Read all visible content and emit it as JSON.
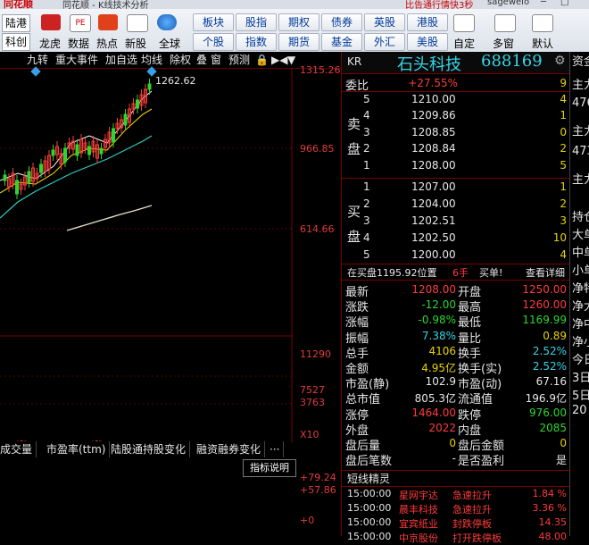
{
  "window": {
    "title_left": "同花顺 - K线技术分析",
    "title_right": "比告通行情快3秒",
    "user": "sagewelo"
  },
  "toolbar": {
    "left_items": [
      "陆港",
      "科创"
    ],
    "icon_labels": [
      "龙虎",
      "数据",
      "热点",
      "新股",
      "全球"
    ],
    "nav_row1": [
      "板块",
      "股指",
      "期权",
      "债券",
      "英股",
      "港股"
    ],
    "nav_row2": [
      "个股",
      "指数",
      "期货",
      "基金",
      "外汇",
      "美股"
    ],
    "right_labels": [
      "自定",
      "多窗",
      "默认"
    ]
  },
  "chart": {
    "tabs": [
      "九转",
      "重大事件",
      "加自选",
      "均线",
      "除权",
      "叠",
      "窗",
      "预测"
    ],
    "peak_label": "1262.62",
    "y_labels": [
      "1315.26",
      "966.85",
      "614.66",
      "11290",
      "7527",
      "3763",
      "X10",
      "+79.24",
      "+57.86",
      "+0"
    ],
    "indicator_tabs": [
      "成交量",
      "市盈率(ttm)",
      "陆股通持股变化",
      "融资融券变化",
      "···"
    ],
    "indicator_button": "指标说明"
  },
  "quote": {
    "code": "KR",
    "name": "石头科技",
    "symbol": "688169",
    "webi_label": "委比",
    "webi_value": "+27.55%",
    "webi_right": "9",
    "sell_label": [
      "卖",
      "盘"
    ],
    "buy_label": [
      "买",
      "盘"
    ],
    "sell": [
      {
        "n": "5",
        "p": "1210.00",
        "v": "4"
      },
      {
        "n": "4",
        "p": "1209.86",
        "v": "1"
      },
      {
        "n": "3",
        "p": "1208.85",
        "v": "0"
      },
      {
        "n": "2",
        "p": "1208.84",
        "v": "2"
      },
      {
        "n": "1",
        "p": "1208.00",
        "v": "5"
      }
    ],
    "buy": [
      {
        "n": "1",
        "p": "1207.00",
        "v": "1"
      },
      {
        "n": "2",
        "p": "1204.00",
        "v": "2"
      },
      {
        "n": "3",
        "p": "1202.51",
        "v": "3"
      },
      {
        "n": "4",
        "p": "1202.50",
        "v": "10"
      },
      {
        "n": "5",
        "p": "1200.00",
        "v": "4"
      }
    ],
    "bar_text": "在买盘1195.92位置",
    "bar_hands": "6手",
    "bar_buy": "买单!",
    "bar_detail": "查看详细",
    "stats_left": [
      {
        "k": "最新",
        "v": "1208.00",
        "c": "red"
      },
      {
        "k": "涨跌",
        "v": "-12.00",
        "c": "green"
      },
      {
        "k": "涨幅",
        "v": "-0.98%",
        "c": "green"
      },
      {
        "k": "振幅",
        "v": "7.38%",
        "c": "cyan"
      },
      {
        "k": "总手",
        "v": "4106",
        "c": "yellow"
      },
      {
        "k": "金额",
        "v": "4.95亿",
        "c": "yellow"
      },
      {
        "k": "市盈(静)",
        "v": "102.9",
        "c": "white"
      },
      {
        "k": "总市值",
        "v": "805.3亿",
        "c": "white"
      },
      {
        "k": "涨停",
        "v": "1464.00",
        "c": "red"
      },
      {
        "k": "外盘",
        "v": "2022",
        "c": "red"
      },
      {
        "k": "盘后量",
        "v": "0",
        "c": "yellow"
      },
      {
        "k": "盘后笔数",
        "v": "-",
        "c": "white"
      }
    ],
    "stats_right": [
      {
        "k": "开盘",
        "v": "1250.00",
        "c": "red"
      },
      {
        "k": "最高",
        "v": "1260.00",
        "c": "red"
      },
      {
        "k": "最低",
        "v": "1169.99",
        "c": "green"
      },
      {
        "k": "量比",
        "v": "0.89",
        "c": "yellow"
      },
      {
        "k": "换手",
        "v": "2.52%",
        "c": "cyan"
      },
      {
        "k": "换手(实)",
        "v": "2.52%",
        "c": "cyan"
      },
      {
        "k": "市盈(动)",
        "v": "67.16",
        "c": "white"
      },
      {
        "k": "流通值",
        "v": "196.9亿",
        "c": "white"
      },
      {
        "k": "跌停",
        "v": "976.00",
        "c": "green"
      },
      {
        "k": "内盘",
        "v": "2085",
        "c": "green"
      },
      {
        "k": "盘后金额",
        "v": "0",
        "c": "yellow"
      },
      {
        "k": "是否盈利",
        "v": "是",
        "c": "white"
      }
    ],
    "sprite_title": "短线精灵",
    "sprites": [
      {
        "t": "15:00:00",
        "name": "星网宇达",
        "ev": "急速拉升",
        "val": "1.84 %"
      },
      {
        "t": "15:00:00",
        "name": "晨丰科技",
        "ev": "急速拉升",
        "val": "3.36 %"
      },
      {
        "t": "15:00:00",
        "name": "宜宾纸业",
        "ev": "封跌停板",
        "val": "14.35"
      },
      {
        "t": "15:00:00",
        "name": "中京股份",
        "ev": "打开跌停板",
        "val": "48.00"
      }
    ]
  },
  "strip": {
    "items": [
      "资金",
      "主力",
      "4765",
      "主力",
      "473",
      "主力",
      "持仓",
      "大单",
      "中单",
      "小单",
      "净特",
      "净大",
      "净中",
      "净小",
      "今日",
      "3日",
      "5日",
      "20"
    ]
  },
  "colors": {
    "up": "#ff3b3b",
    "down": "#2dd62d",
    "accent": "#e6d200",
    "grid": "#7a0000"
  }
}
